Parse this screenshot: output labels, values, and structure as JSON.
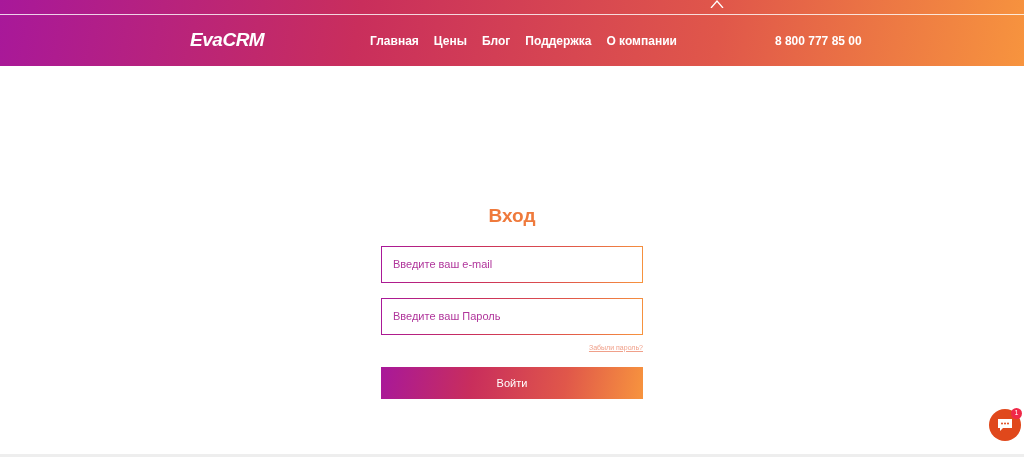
{
  "header": {
    "logo": "EvaCRM",
    "nav": [
      "Главная",
      "Цены",
      "Блог",
      "Поддержка",
      "О компании"
    ],
    "phone": "8 800 777 85 00"
  },
  "login": {
    "title": "Вход",
    "fields": [
      {
        "placeholder": "Введите ваш e-mail"
      },
      {
        "placeholder": "Введите ваш Пароль"
      }
    ],
    "forgot_link": "Забыли пароль?",
    "submit": "Войти"
  },
  "chat": {
    "badge": "1"
  }
}
